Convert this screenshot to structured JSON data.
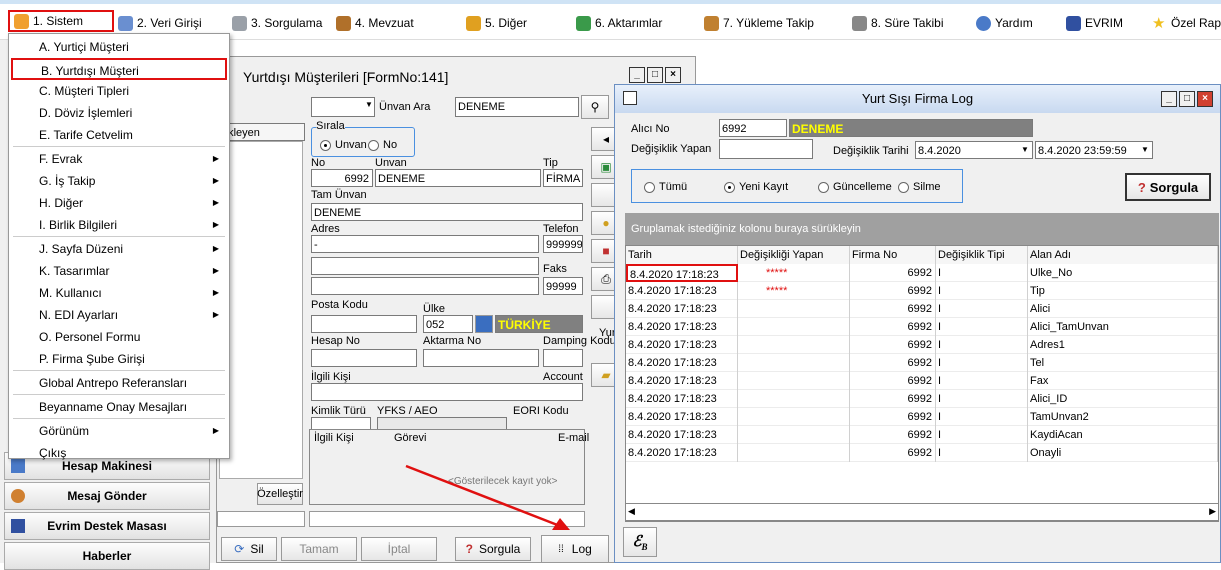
{
  "menubar": {
    "items": [
      {
        "label": "1. Sistem",
        "icon": "system-icon"
      },
      {
        "label": "2. Veri Girişi",
        "icon": "data-entry-icon"
      },
      {
        "label": "3. Sorgulama",
        "icon": "query-icon"
      },
      {
        "label": "4. Mevzuat",
        "icon": "books-icon"
      },
      {
        "label": "5. Diğer",
        "icon": "people-icon"
      },
      {
        "label": "6. Aktarımlar",
        "icon": "transfer-icon"
      },
      {
        "label": "7. Yükleme Takip",
        "icon": "truck-icon"
      },
      {
        "label": "8. Süre Takibi",
        "icon": "calendar-icon"
      },
      {
        "label": "Yardım",
        "icon": "help-icon"
      },
      {
        "label": "EVRIM",
        "icon": "evrim-icon"
      },
      {
        "label": "Özel Rapo",
        "icon": "star-icon"
      }
    ]
  },
  "dropdown": {
    "items": [
      {
        "label": "A. Yurtiçi Müşteri",
        "submenu": false
      },
      {
        "label": "B. Yurtdışı Müşteri",
        "submenu": false
      },
      {
        "label": "C. Müşteri Tipleri",
        "submenu": false
      },
      {
        "label": "D. Döviz İşlemleri",
        "submenu": false
      },
      {
        "label": "E. Tarife Cetvelim",
        "submenu": false
      },
      {
        "label": "F. Evrak",
        "submenu": true
      },
      {
        "label": "G. İş Takip",
        "submenu": true
      },
      {
        "label": "H. Diğer",
        "submenu": true
      },
      {
        "label": "I. Birlik Bilgileri",
        "submenu": true
      },
      {
        "label": "J. Sayfa Düzeni",
        "submenu": true
      },
      {
        "label": "K. Tasarımlar",
        "submenu": true
      },
      {
        "label": "M. Kullanıcı",
        "submenu": true
      },
      {
        "label": "N. EDI Ayarları",
        "submenu": true
      },
      {
        "label": "O. Personel Formu",
        "submenu": false
      },
      {
        "label": "P. Firma Şube Girişi",
        "submenu": false
      },
      {
        "label": "Global Antrepo Referansları",
        "submenu": false
      },
      {
        "label": "Beyanname Onay Mesajları",
        "submenu": false
      },
      {
        "label": "Görünüm",
        "submenu": true
      },
      {
        "label": "Çıkış",
        "submenu": false
      }
    ]
  },
  "leftpanel": {
    "buttons": [
      "Hesap Makinesi",
      "Mesaj Gönder",
      "Evrim Destek Masası",
      "Haberler"
    ]
  },
  "form": {
    "title": "Yurtdışı Müşterileri [FormNo:141]",
    "search_label": "Ünvan Ara",
    "search_value": "DENEME",
    "list_header": "ekleyen",
    "sort_label": "Sırala",
    "sort_options": [
      "Unvan",
      "No"
    ],
    "no_label": "No",
    "no_value": "6992",
    "unvan_label": "Unvan",
    "unvan_value": "DENEME",
    "tip_label": "Tip",
    "tip_value": "FİRMA",
    "tam_unvan_label": "Tam Ünvan",
    "tam_unvan_value": "DENEME",
    "adres_label": "Adres",
    "adres_value": "-",
    "telefon_label": "Telefon",
    "telefon_value": "999999",
    "faks_label": "Faks",
    "faks_value": "99999",
    "posta_kodu_label": "Posta Kodu",
    "ulke_label": "Ülke",
    "ulke_code": "052",
    "ulke_name": "TÜRKİYE",
    "hesap_no_label": "Hesap No",
    "aktarma_no_label": "Aktarma No",
    "damping_label": "Damping Kodu",
    "ilgili_kisi_label": "İlgili Kişi",
    "account_label": "Account",
    "kimlik_turu_label": "Kimlik Türü",
    "yfks_label": "YFKS / AEO",
    "eori_label": "EORI Kodu",
    "contact_cols": [
      "İlgili Kişi",
      "Görevi",
      "E-mail"
    ],
    "empty_text": "<Gösterilecek kayıt yok>",
    "customize_label": "Özelleştir",
    "side_label": "Yur",
    "buttons": {
      "sil": "Sil",
      "tamam": "Tamam",
      "iptal": "İptal",
      "sorgula": "Sorgula",
      "log": "Log"
    }
  },
  "log": {
    "title": "Yurt Sışı Firma Log",
    "alici_no_label": "Alıcı No",
    "alici_no_value": "6992",
    "alici_name": "DENEME",
    "degistiren_label": "Değişiklik Yapan",
    "tarih_label": "Değişiklik Tarihi",
    "tarih_from": "8.4.2020",
    "tarih_to": "8.4.2020 23:59:59",
    "radio_options": [
      "Tümü",
      "Yeni Kayıt",
      "Güncelleme",
      "Silme"
    ],
    "radio_selected": 1,
    "sorgula_label": "Sorgula",
    "group_hint": "Gruplamak istediğiniz kolonu buraya sürükleyin",
    "columns": [
      "Tarih",
      "Değişikliği Yapan",
      "Firma No",
      "Değişiklik Tipi",
      "Alan Adı"
    ],
    "rows": [
      {
        "tarih": "8.4.2020 17:18:23",
        "yapan": "*****",
        "firma": "6992",
        "tip": "I",
        "alan": "Ulke_No"
      },
      {
        "tarih": "8.4.2020 17:18:23",
        "yapan": "*****",
        "firma": "6992",
        "tip": "I",
        "alan": "Tip"
      },
      {
        "tarih": "8.4.2020 17:18:23",
        "yapan": "",
        "firma": "6992",
        "tip": "I",
        "alan": "Alici"
      },
      {
        "tarih": "8.4.2020 17:18:23",
        "yapan": "",
        "firma": "6992",
        "tip": "I",
        "alan": "Alici_TamUnvan"
      },
      {
        "tarih": "8.4.2020 17:18:23",
        "yapan": "",
        "firma": "6992",
        "tip": "I",
        "alan": "Adres1"
      },
      {
        "tarih": "8.4.2020 17:18:23",
        "yapan": "",
        "firma": "6992",
        "tip": "I",
        "alan": "Tel"
      },
      {
        "tarih": "8.4.2020 17:18:23",
        "yapan": "",
        "firma": "6992",
        "tip": "I",
        "alan": "Fax"
      },
      {
        "tarih": "8.4.2020 17:18:23",
        "yapan": "",
        "firma": "6992",
        "tip": "I",
        "alan": "Alici_ID"
      },
      {
        "tarih": "8.4.2020 17:18:23",
        "yapan": "",
        "firma": "6992",
        "tip": "I",
        "alan": "TamUnvan2"
      },
      {
        "tarih": "8.4.2020 17:18:23",
        "yapan": "",
        "firma": "6992",
        "tip": "I",
        "alan": "KaydiAcan"
      },
      {
        "tarih": "8.4.2020 17:18:23",
        "yapan": "",
        "firma": "6992",
        "tip": "I",
        "alan": "Onayli"
      }
    ]
  },
  "colors": {
    "accent": "#e01010",
    "highlight": "#ffff00",
    "name_bg": "#808080"
  }
}
